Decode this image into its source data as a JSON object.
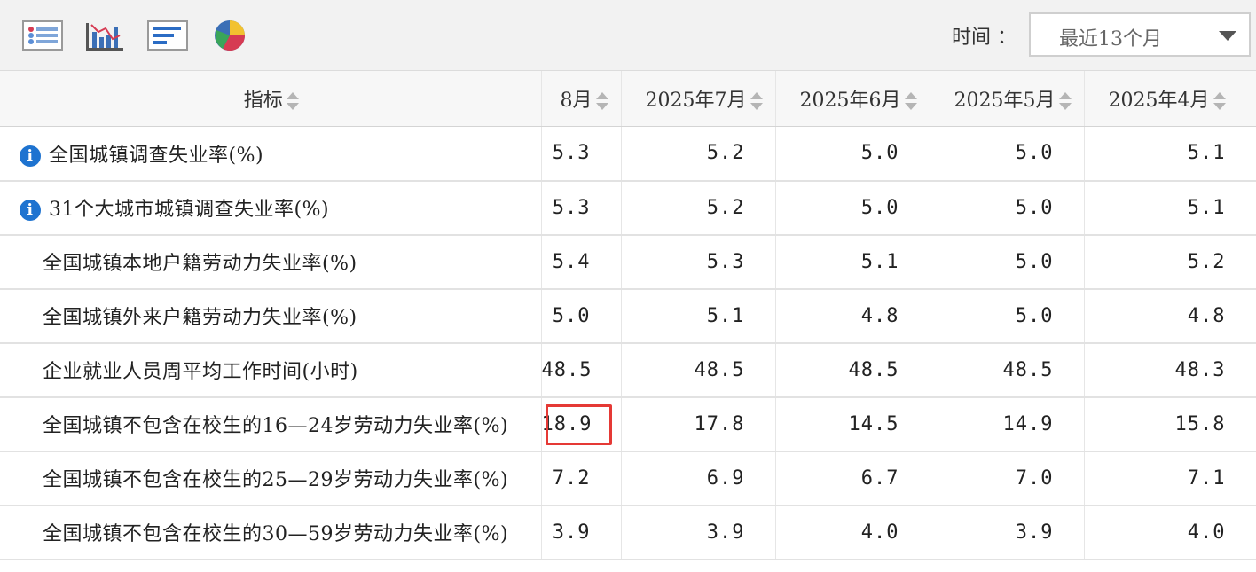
{
  "toolbar": {
    "icons": [
      "list-view-icon",
      "bar-chart-icon",
      "horizontal-bar-icon",
      "pie-chart-icon"
    ],
    "time_label": "时间 ：",
    "time_value": "最近13个月"
  },
  "table": {
    "headers": [
      "指标",
      "8月",
      "2025年7月",
      "2025年6月",
      "2025年5月",
      "2025年4月"
    ],
    "rows": [
      {
        "indicator": "全国城镇调查失业率(%)",
        "values": [
          "5.3",
          "5.2",
          "5.0",
          "5.0",
          "5.1"
        ]
      },
      {
        "indicator": "31个大城市城镇调查失业率(%)",
        "values": [
          "5.3",
          "5.2",
          "5.0",
          "5.0",
          "5.1"
        ]
      },
      {
        "indicator": "全国城镇本地户籍劳动力失业率(%)",
        "values": [
          "5.4",
          "5.3",
          "5.1",
          "5.0",
          "5.2"
        ]
      },
      {
        "indicator": "全国城镇外来户籍劳动力失业率(%)",
        "values": [
          "5.0",
          "5.1",
          "4.8",
          "5.0",
          "4.8"
        ]
      },
      {
        "indicator": "企业就业人员周平均工作时间(小时)",
        "values": [
          "48.5",
          "48.5",
          "48.5",
          "48.5",
          "48.3"
        ]
      },
      {
        "indicator": "全国城镇不包含在校生的16—24岁劳动力失业率(%)",
        "values": [
          "18.9",
          "17.8",
          "14.5",
          "14.9",
          "15.8"
        ]
      },
      {
        "indicator": "全国城镇不包含在校生的25—29岁劳动力失业率(%)",
        "values": [
          "7.2",
          "6.9",
          "6.7",
          "7.0",
          "7.1"
        ]
      },
      {
        "indicator": "全国城镇不包含在校生的30—59岁劳动力失业率(%)",
        "values": [
          "3.9",
          "3.9",
          "4.0",
          "3.9",
          "4.0"
        ]
      }
    ]
  },
  "colors": {
    "highlight": "#e53935",
    "info": "#1e73d0"
  }
}
